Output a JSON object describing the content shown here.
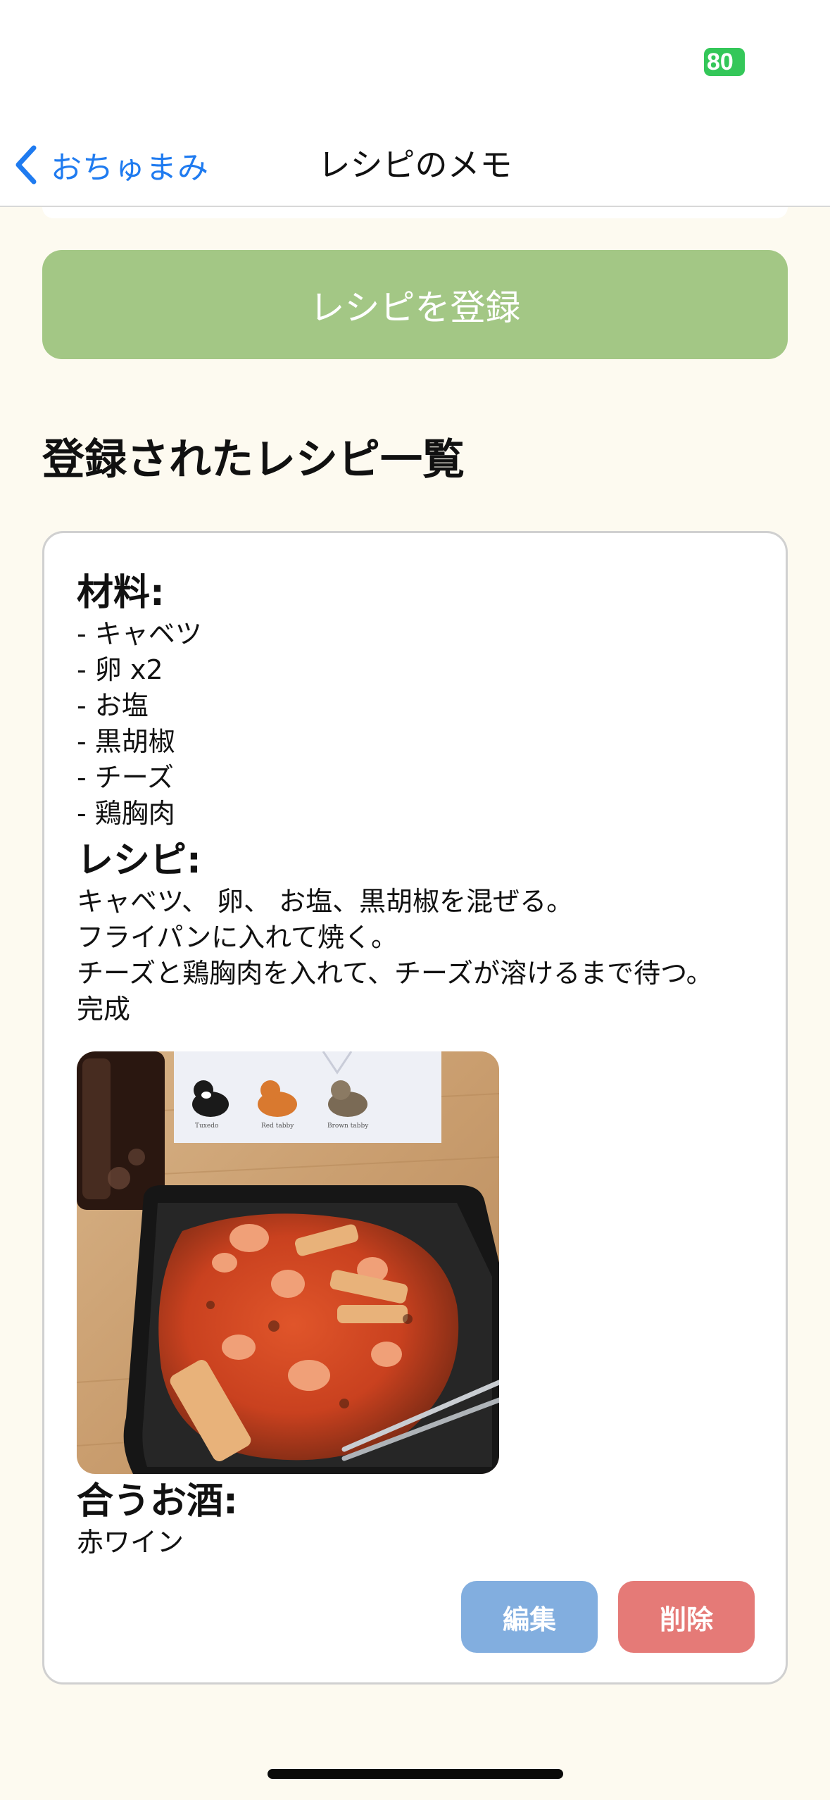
{
  "status_bar": {
    "battery_level": "80"
  },
  "nav": {
    "back_label": "おちゅまみ",
    "title": "レシピのメモ"
  },
  "register_button_label": "レシピを登録",
  "list_heading": "登録されたレシピ一覧",
  "recipe": {
    "ingredients_label": "材料:",
    "ingredients": [
      "- キャベツ",
      "- 卵 x2",
      "- お塩",
      "- 黒胡椒",
      "- チーズ",
      "- 鶏胸肉"
    ],
    "recipe_label": "レシピ:",
    "steps": [
      "キャベツ、 卵、 お塩、黒胡椒を混ぜる。",
      "フライパンに入れて焼く。",
      "チーズと鶏胸肉を入れて、チーズが溶けるまで待つ。",
      "完成"
    ],
    "photo_tag_labels": [
      "Tuxedo",
      "Red tabby",
      "Brown tabby"
    ],
    "sake_label": "合うお酒:",
    "sake": "赤ワイン",
    "edit_label": "編集",
    "delete_label": "削除"
  },
  "colors": {
    "background": "#fdfaf0",
    "register_button": "#a3c785",
    "edit_button": "#82aedf",
    "delete_button": "#e57a77",
    "link": "#1f7bf0",
    "battery": "#34c759"
  },
  "icons": {
    "back": "chevron-left-icon"
  }
}
